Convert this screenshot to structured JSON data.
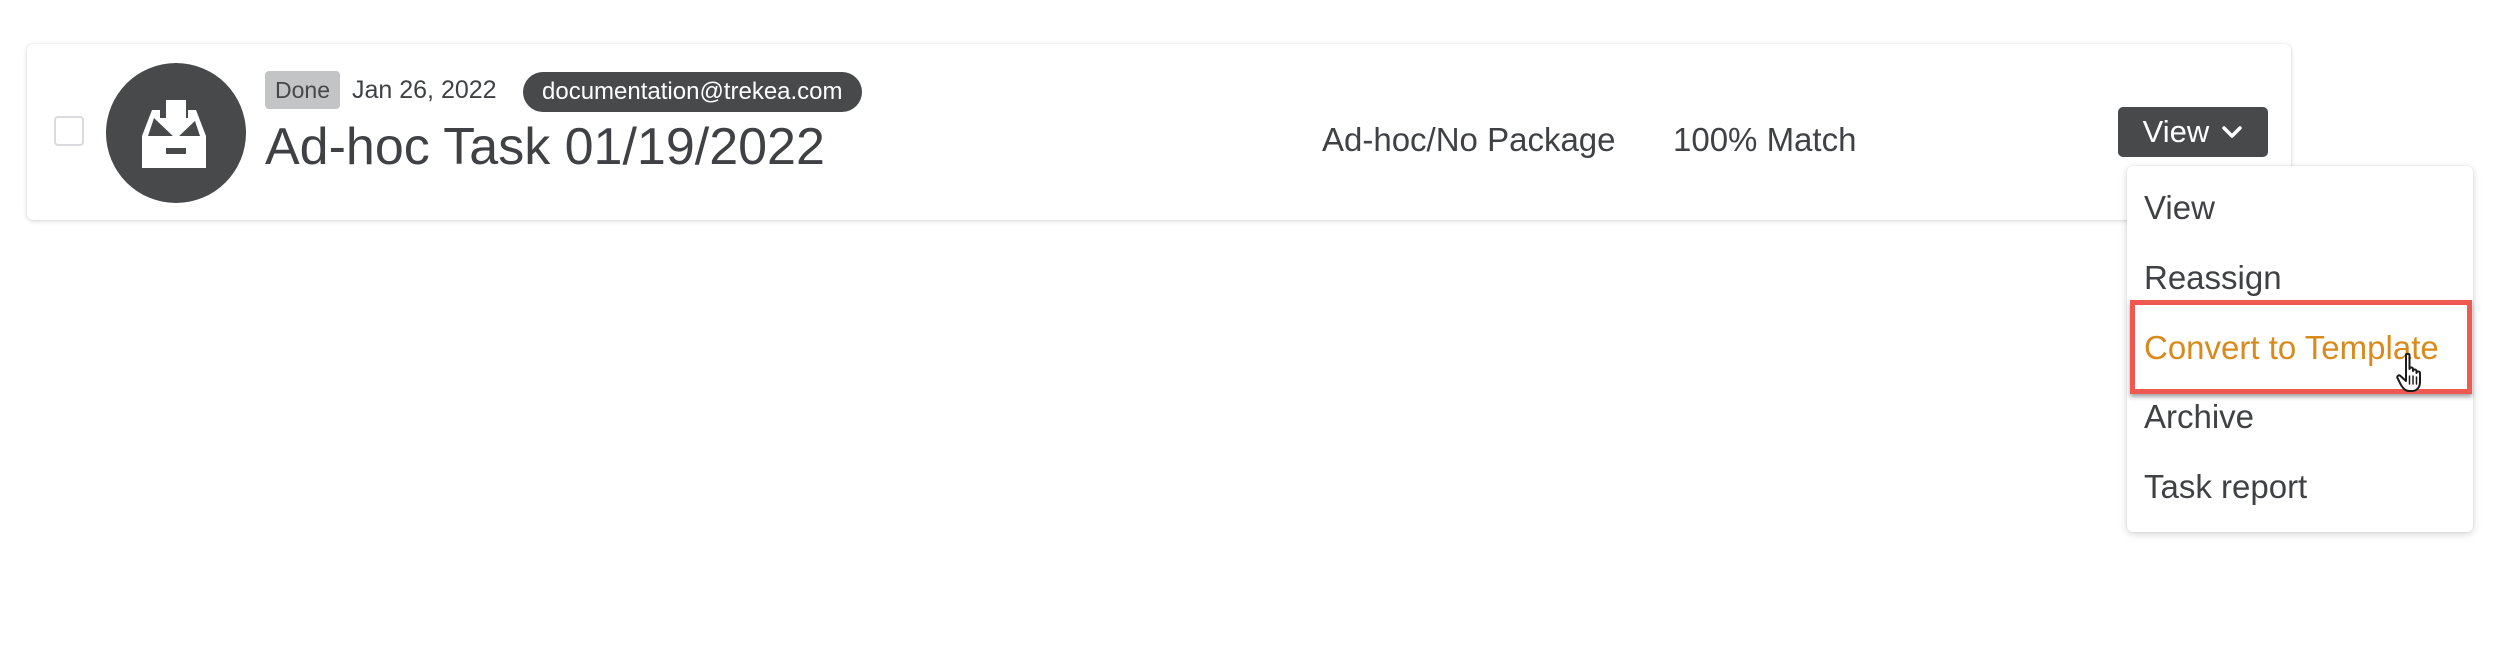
{
  "task": {
    "status": "Done",
    "date": "Jan 26, 2022",
    "assignee": "documentation@trekea.com",
    "title": "Ad-hoc Task 01/19/2022",
    "package": "Ad-hoc/No Package",
    "match": "100% Match",
    "icon": "inbox-download-icon"
  },
  "actions": {
    "view_button_label": "View",
    "menu_items": [
      {
        "label": "View"
      },
      {
        "label": "Reassign"
      },
      {
        "label": "Convert to Template",
        "highlighted": true
      },
      {
        "label": "Archive"
      },
      {
        "label": "Task report"
      }
    ]
  },
  "colors": {
    "dark": "#48494b",
    "highlight_text": "#d98a1c",
    "highlight_border": "#ee5a52",
    "badge_bg": "#c3c4c6"
  }
}
